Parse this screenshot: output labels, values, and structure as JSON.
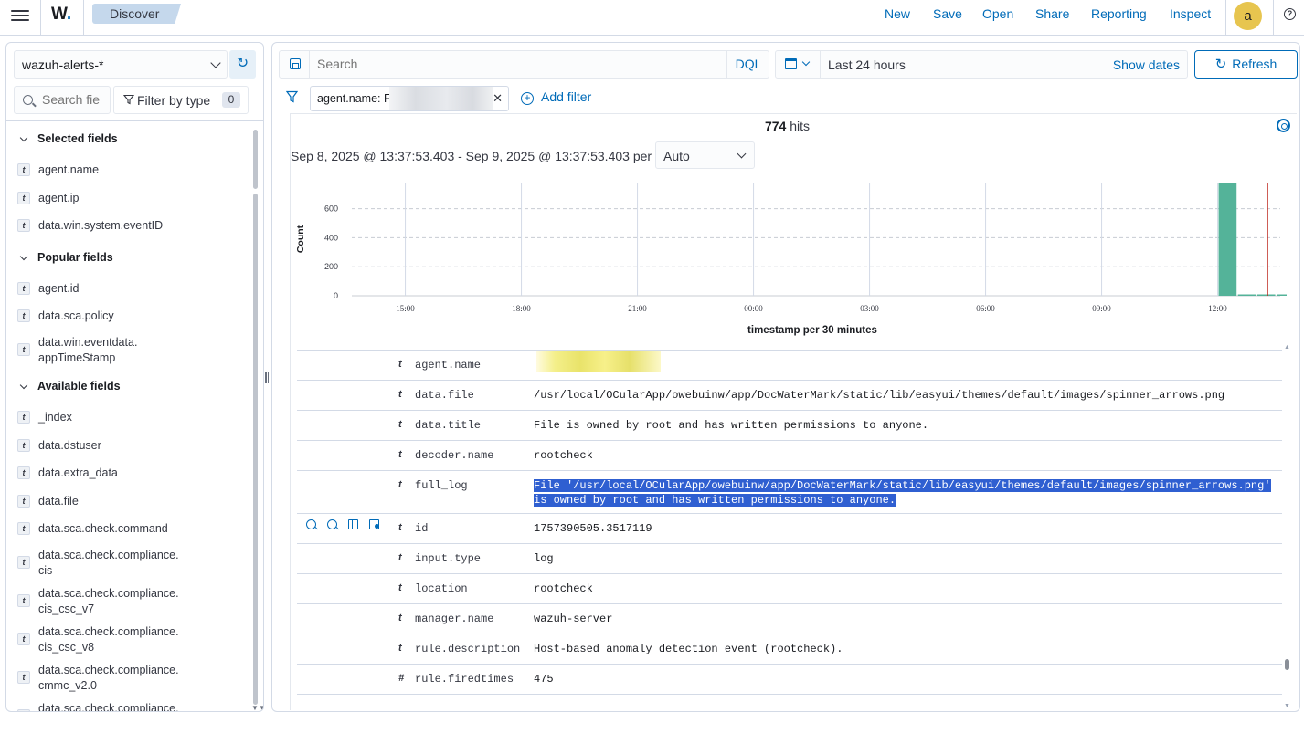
{
  "header": {
    "logo_text": "W",
    "logo_dot": ".",
    "breadcrumb": "Discover",
    "menu": [
      "New",
      "Save",
      "Open",
      "Share",
      "Reporting",
      "Inspect"
    ],
    "avatar": "a",
    "help": "?"
  },
  "sidebar": {
    "index_pattern": "wazuh-alerts-*",
    "search_placeholder": "Search field names",
    "search_visible": "Search fie",
    "filter_by_type": "Filter by type",
    "filter_count": "0",
    "selected_title": "Selected fields",
    "selected": [
      {
        "type": "t",
        "name": "agent.name"
      },
      {
        "type": "t",
        "name": "agent.ip"
      },
      {
        "type": "t",
        "name": "data.win.system.eventID"
      }
    ],
    "popular_title": "Popular fields",
    "popular": [
      {
        "type": "t",
        "name": "agent.id"
      },
      {
        "type": "t",
        "name": "data.sca.policy"
      },
      {
        "type": "t",
        "name": "data.win.eventdata.",
        "name2": "appTimeStamp"
      }
    ],
    "available_title": "Available fields",
    "available": [
      {
        "type": "t",
        "name": "_index"
      },
      {
        "type": "t",
        "name": "data.dstuser"
      },
      {
        "type": "t",
        "name": "data.extra_data"
      },
      {
        "type": "t",
        "name": "data.file"
      },
      {
        "type": "t",
        "name": "data.sca.check.command"
      },
      {
        "type": "t",
        "name": "data.sca.check.compliance.",
        "name2": "cis"
      },
      {
        "type": "t",
        "name": "data.sca.check.compliance.",
        "name2": "cis_csc_v7"
      },
      {
        "type": "t",
        "name": "data.sca.check.compliance.",
        "name2": "cis_csc_v8"
      },
      {
        "type": "t",
        "name": "data.sca.check.compliance.",
        "name2": "cmmc_v2.0"
      },
      {
        "type": "t",
        "name": "data.sca.check.compliance."
      }
    ]
  },
  "query": {
    "placeholder": "Search",
    "language": "DQL",
    "date_range": "Last 24 hours",
    "show_dates": "Show dates",
    "refresh": "Refresh"
  },
  "filters": {
    "pill": "agent.name: F",
    "add_filter": "Add filter"
  },
  "results": {
    "hits_count": "774",
    "hits_label": "hits",
    "range": "Sep 8, 2025 @ 13:37:53.403 - Sep 9, 2025 @ 13:37:53.403 per",
    "interval": "Auto"
  },
  "chart_data": {
    "type": "bar",
    "ylabel": "Count",
    "xlabel": "timestamp per 30 minutes",
    "ylim": [
      0,
      780
    ],
    "yticks": [
      0,
      200,
      400,
      600
    ],
    "xticks": [
      "15:00",
      "18:00",
      "21:00",
      "00:00",
      "03:00",
      "06:00",
      "09:00",
      "12:00"
    ],
    "x_start": "13:37",
    "x_end": "13:37 (+24h)",
    "bars": [
      {
        "bucket": "12:00",
        "value": 774
      },
      {
        "bucket": "12:30",
        "value": 0
      },
      {
        "bucket": "13:00",
        "value": 0
      },
      {
        "bucket": "13:30",
        "value": 0
      }
    ],
    "grid": true,
    "bar_color": "#54b399",
    "now_marker_color": "#bd271e"
  },
  "document": {
    "rows": [
      {
        "type": "t",
        "field": "agent.name",
        "value": ""
      },
      {
        "type": "t",
        "field": "data.file",
        "value": "/usr/local/OCularApp/owebuinw/app/DocWaterMark/static/lib/easyui/themes/default/images/spinner_arrows.png"
      },
      {
        "type": "t",
        "field": "data.title",
        "value": "File is owned by root and has written permissions to anyone."
      },
      {
        "type": "t",
        "field": "decoder.name",
        "value": "rootcheck"
      },
      {
        "type": "t",
        "field": "full_log",
        "value": "File '/usr/local/OCularApp/owebuinw/app/DocWaterMark/static/lib/easyui/themes/default/images/spinner_arrows.png' is owned by root and has written permissions to anyone."
      },
      {
        "type": "t",
        "field": "id",
        "value": "1757390505.3517119"
      },
      {
        "type": "t",
        "field": "input.type",
        "value": "log"
      },
      {
        "type": "t",
        "field": "location",
        "value": "rootcheck"
      },
      {
        "type": "t",
        "field": "manager.name",
        "value": "wazuh-server"
      },
      {
        "type": "t",
        "field": "rule.description",
        "value": "Host-based anomaly detection event (rootcheck)."
      },
      {
        "type": "#",
        "field": "rule.firedtimes",
        "value": "475"
      }
    ]
  },
  "colors": {
    "accent": "#006bb8",
    "breadcrumb_bg": "#c5d8ec",
    "avatar_bg": "#e7c54f",
    "selection": "#2f5fd1"
  }
}
